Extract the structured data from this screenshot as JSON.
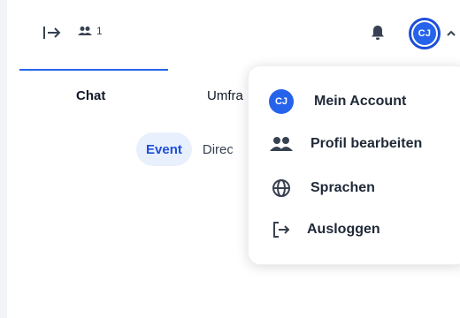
{
  "header": {
    "participants_count": "1",
    "avatar_initials": "CJ"
  },
  "tabs": [
    {
      "label": "Chat",
      "active": true
    },
    {
      "label": "Umfra"
    }
  ],
  "subtabs": [
    {
      "label": "Event",
      "active": true
    },
    {
      "label": "Direc"
    }
  ],
  "menu": {
    "items": [
      {
        "label": "Mein Account",
        "icon": "avatar-icon"
      },
      {
        "label": "Profil bearbeiten",
        "icon": "people-icon"
      },
      {
        "label": "Sprachen",
        "icon": "globe-icon"
      },
      {
        "label": "Ausloggen",
        "icon": "logout-icon"
      }
    ]
  },
  "colors": {
    "accent": "#2563eb",
    "active_pill_bg": "#e8f0fe"
  }
}
